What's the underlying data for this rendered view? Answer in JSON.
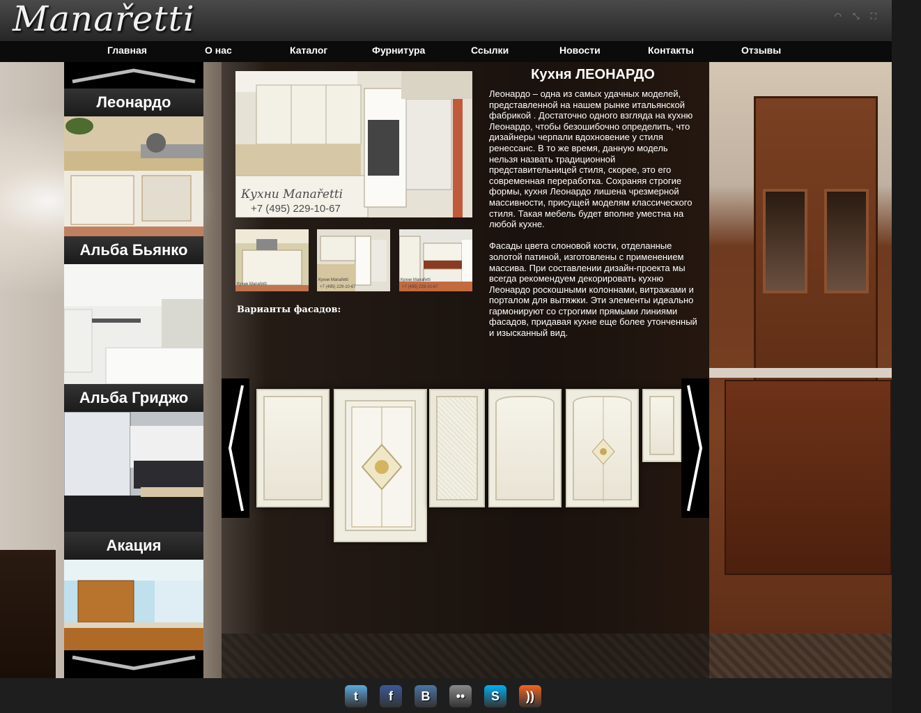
{
  "header": {
    "logo_text": "Manařetti",
    "window_controls": [
      "headphones-icon",
      "shrink-icon",
      "fullscreen-icon"
    ]
  },
  "nav": {
    "items": [
      {
        "label": "Главная"
      },
      {
        "label": "О нас"
      },
      {
        "label": "Каталог"
      },
      {
        "label": "Фурнитура"
      },
      {
        "label": "Ссылки"
      },
      {
        "label": "Новости"
      },
      {
        "label": "Контакты"
      },
      {
        "label": "Отзывы"
      }
    ]
  },
  "sidebar": {
    "items": [
      {
        "label": "Леонардо"
      },
      {
        "label": "Альба Бьянко"
      },
      {
        "label": "Альба Гриджо"
      },
      {
        "label": "Акация"
      }
    ]
  },
  "product": {
    "title": "Кухня ЛЕОНАРДО",
    "paragraph1": "Леонардо – одна из самых удачных моделей, представленной на нашем рынке итальянской фабрикой . Достаточно одного взгляда на кухню Леонардо, чтобы безошибочно определить, что дизайнеры черпали вдохновение у стиля ренессанс. В то же время, данную модель нельзя назвать традиционной представительницей стиля, скорее, это его современная переработка. Сохраняя строгие формы, кухня Леонардо лишена чрезмерной массивности, присущей моделям классического стиля. Такая мебель будет вполне уместна на любой кухне.",
    "paragraph2": "Фасады цвета слоновой кости, отделанные золотой патиной, изготовлены с применением массива. При составлении дизайн-проекта мы всегда рекомендуем декорировать кухню Леонардо роскошными колоннами, витражами и порталом для вытяжки. Эти элементы идеально гармонируют со строгими прямыми линиями фасадов, придавая кухне еще более утонченный и изысканный вид.",
    "variants_label": "Варианты фасадов:",
    "image_watermark": "Кухни Manařetti",
    "image_phone": "+7 (495) 229-10-67",
    "thumb_watermark": "Кухни Manařetti",
    "thumb_phone": "+7 (495) 229-10-67"
  },
  "footer": {
    "social": [
      {
        "icon": "twitter-icon",
        "glyph": "t",
        "color": "#5ea9dd"
      },
      {
        "icon": "facebook-icon",
        "glyph": "f",
        "color": "#3b5998"
      },
      {
        "icon": "vk-icon",
        "glyph": "B",
        "color": "#4c75a3"
      },
      {
        "icon": "flickr-icon",
        "glyph": "••",
        "color": "#8a8a8a"
      },
      {
        "icon": "skype-icon",
        "glyph": "S",
        "color": "#00aff0"
      },
      {
        "icon": "rss-icon",
        "glyph": "))",
        "color": "#f26522"
      }
    ]
  }
}
